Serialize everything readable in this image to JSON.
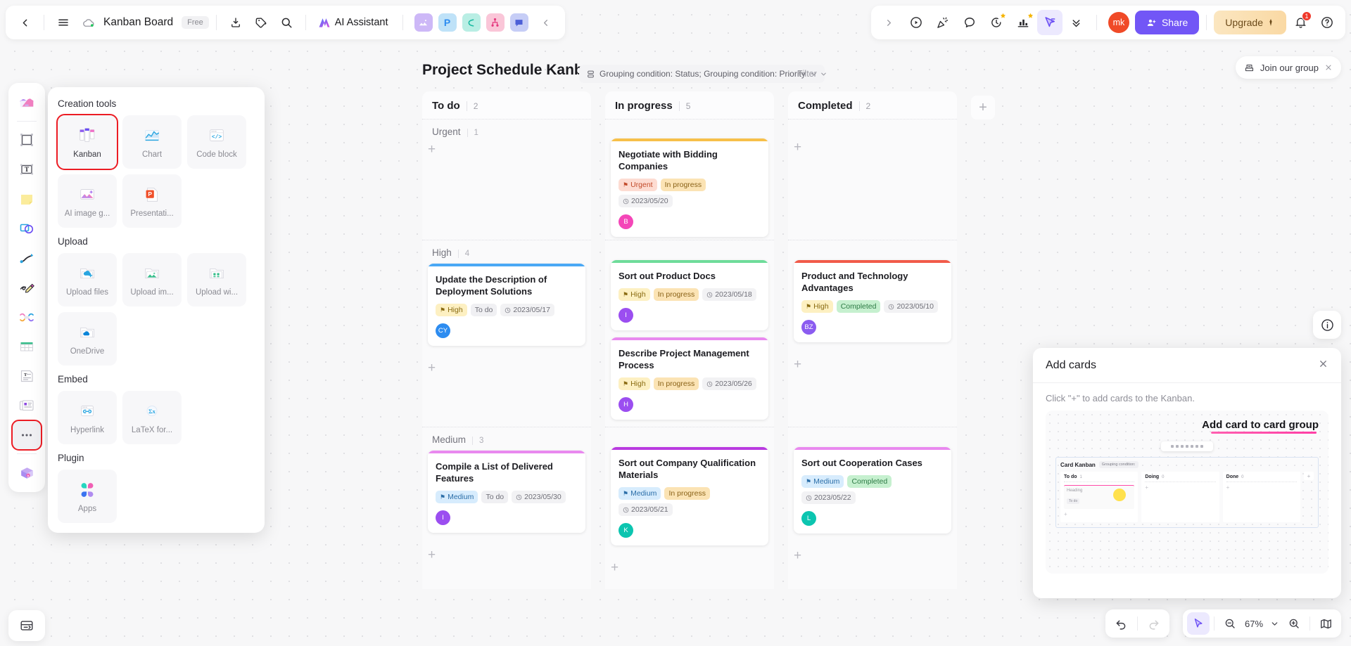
{
  "topbar": {
    "back_icon": "chevron-left-icon",
    "menu_icon": "hamburger-menu-icon",
    "cloud_icon": "cloud-sync-icon",
    "doc_title": "Kanban Board",
    "plan_badge": "Free",
    "download_icon": "download-icon",
    "tag_icon": "tag-icon",
    "search_icon": "search-icon",
    "ai_assistant_label": "AI Assistant",
    "applets": [
      {
        "name": "ai-image-applet",
        "color": "#cdb8f7"
      },
      {
        "name": "presentation-applet",
        "color": "#bfe2f8"
      },
      {
        "name": "mindmap-applet",
        "color": "#b9eee4"
      },
      {
        "name": "flowchart-applet",
        "color": "#fac6d8"
      },
      {
        "name": "comment-applet",
        "color": "#c6cdf6"
      }
    ],
    "collapse_icon": "chevron-left-icon",
    "right_tools": [
      {
        "name": "expand-right-icon",
        "glyph": "chevron-right-icon"
      },
      {
        "name": "present-icon",
        "glyph": "play-circle-icon"
      },
      {
        "name": "celebrate-icon",
        "glyph": "party-popper-icon"
      },
      {
        "name": "comment-icon",
        "glyph": "speech-bubble-icon"
      },
      {
        "name": "timer-icon",
        "glyph": "timer-star-icon"
      },
      {
        "name": "vote-icon",
        "glyph": "chart-star-icon"
      },
      {
        "name": "pointer-share-icon",
        "glyph": "cursor-list-icon"
      },
      {
        "name": "more-tools-icon",
        "glyph": "double-chevron-down-icon"
      }
    ],
    "avatar_initials": "mk",
    "share_label": "Share",
    "share_icon": "user-plus-icon",
    "upgrade_label": "Upgrade",
    "upgrade_icon": "diamond-icon",
    "bell_icon": "bell-icon",
    "bell_count": "1",
    "help_icon": "question-circle-icon"
  },
  "rail": {
    "items": [
      {
        "name": "rail-item-templates",
        "icon": "template-gallery-icon",
        "selected": false
      },
      {
        "name": "rail-item-frame",
        "icon": "frame-icon",
        "selected": false
      },
      {
        "name": "rail-item-text",
        "icon": "text-box-icon",
        "selected": false
      },
      {
        "name": "rail-item-sticky",
        "icon": "sticky-note-icon",
        "selected": false
      },
      {
        "name": "rail-item-shape",
        "icon": "shapes-icon",
        "selected": false
      },
      {
        "name": "rail-item-connector",
        "icon": "connector-line-icon",
        "selected": false
      },
      {
        "name": "rail-item-pen",
        "icon": "pen-scribble-icon",
        "selected": false
      },
      {
        "name": "rail-item-relation",
        "icon": "relation-icon",
        "selected": false
      },
      {
        "name": "rail-item-table",
        "icon": "table-icon",
        "selected": false
      },
      {
        "name": "rail-item-doc",
        "icon": "document-icon",
        "selected": false
      },
      {
        "name": "rail-item-cards",
        "icon": "cards-icon",
        "selected": false
      },
      {
        "name": "rail-item-more",
        "icon": "more-dots-icon",
        "selected": true
      },
      {
        "name": "rail-item-assets",
        "icon": "asset-box-icon",
        "selected": false
      }
    ],
    "bottom_icon": "export-board-icon"
  },
  "creation_popover": {
    "sections": [
      {
        "title": "Creation tools",
        "items": [
          {
            "label": "Kanban",
            "icon": "kanban-icon",
            "selected": true
          },
          {
            "label": "Chart",
            "icon": "chart-icon",
            "selected": false
          },
          {
            "label": "Code block",
            "icon": "code-block-icon",
            "selected": false
          },
          {
            "label": "AI image g...",
            "icon": "ai-image-icon",
            "selected": false
          },
          {
            "label": "Presentati...",
            "icon": "presentation-icon",
            "selected": false
          }
        ]
      },
      {
        "title": "Upload",
        "items": [
          {
            "label": "Upload files",
            "icon": "upload-files-icon",
            "selected": false
          },
          {
            "label": "Upload im...",
            "icon": "upload-image-icon",
            "selected": false
          },
          {
            "label": "Upload wi...",
            "icon": "upload-widget-icon",
            "selected": false
          },
          {
            "label": "OneDrive",
            "icon": "onedrive-icon",
            "selected": false
          }
        ]
      },
      {
        "title": "Embed",
        "items": [
          {
            "label": "Hyperlink",
            "icon": "hyperlink-icon",
            "selected": false
          },
          {
            "label": "LaTeX for...",
            "icon": "latex-formula-icon",
            "selected": false
          }
        ]
      },
      {
        "title": "Plugin",
        "items": [
          {
            "label": "Apps",
            "icon": "apps-icon",
            "selected": false
          }
        ]
      }
    ]
  },
  "board": {
    "title": "Project Schedule Kanban",
    "grouping_icon": "grouping-icon",
    "grouping_label": "Grouping condition: Status; Grouping condition: Priority",
    "filter_label": "Filter",
    "join_group_label": "Join our group",
    "join_group_icon": "mailbox-icon",
    "join_group_close_icon": "close-icon",
    "info_icon": "info-circle-icon",
    "add_column_icon": "plus-icon",
    "columns": [
      {
        "name": "To do",
        "count": "2",
        "swimlanes": [
          {
            "name": "Urgent",
            "count": "1",
            "cards": []
          },
          {
            "name": "High",
            "count": "4",
            "cards": [
              {
                "title": "Update the Description of Deployment Solutions",
                "bar_color": "#4aa8f5",
                "priority": "High",
                "priority_bg": "#fdf0c2",
                "priority_fg": "#8a6b12",
                "status": "To do",
                "status_bg": "#f0f0f3",
                "status_fg": "#6e6e77",
                "date": "2023/05/17",
                "avatar": "CY",
                "avatar_color": "#2d8cf0"
              }
            ]
          },
          {
            "name": "Medium",
            "count": "3",
            "cards": [
              {
                "title": "Compile a List of Delivered Features",
                "bar_color": "#e989ef",
                "priority": "Medium",
                "priority_bg": "#d7ecfd",
                "priority_fg": "#2b6ea8",
                "status": "To do",
                "status_bg": "#f0f0f3",
                "status_fg": "#6e6e77",
                "date": "2023/05/30",
                "avatar": "I",
                "avatar_color": "#9b4ef0"
              }
            ]
          }
        ]
      },
      {
        "name": "In progress",
        "count": "5",
        "swimlanes": [
          {
            "name": "",
            "count": "",
            "cards": [
              {
                "title": "Negotiate with Bidding Companies",
                "bar_color": "#f7c04a",
                "priority": "Urgent",
                "priority_bg": "#fddcd2",
                "priority_fg": "#c24a2a",
                "status": "In progress",
                "status_bg": "#fbe3b4",
                "status_fg": "#8a6218",
                "date": "2023/05/20",
                "avatar": "B",
                "avatar_color": "#f446b8"
              }
            ]
          },
          {
            "name": "",
            "count": "",
            "cards": [
              {
                "title": "Sort out Product Docs",
                "bar_color": "#6edc9a",
                "priority": "High",
                "priority_bg": "#fdf0c2",
                "priority_fg": "#8a6b12",
                "status": "In progress",
                "status_bg": "#fbe3b4",
                "status_fg": "#8a6218",
                "date": "2023/05/18",
                "avatar": "I",
                "avatar_color": "#9b4ef0"
              },
              {
                "title": "Describe Project Management Process",
                "bar_color": "#e989ef",
                "priority": "High",
                "priority_bg": "#fdf0c2",
                "priority_fg": "#8a6b12",
                "status": "In progress",
                "status_bg": "#fbe3b4",
                "status_fg": "#8a6218",
                "date": "2023/05/26",
                "avatar": "H",
                "avatar_color": "#9b4ef0"
              }
            ]
          },
          {
            "name": "",
            "count": "",
            "cards": [
              {
                "title": "Sort out Company Qualification Materials",
                "bar_color": "#b93ae0",
                "priority": "Medium",
                "priority_bg": "#d7ecfd",
                "priority_fg": "#2b6ea8",
                "status": "In progress",
                "status_bg": "#fbe3b4",
                "status_fg": "#8a6218",
                "date": "2023/05/21",
                "avatar": "K",
                "avatar_color": "#0cc5b0"
              }
            ]
          }
        ]
      },
      {
        "name": "Completed",
        "count": "2",
        "swimlanes": [
          {
            "name": "",
            "count": "",
            "cards": []
          },
          {
            "name": "",
            "count": "",
            "cards": [
              {
                "title": "Product and Technology Advantages",
                "bar_color": "#f15b4a",
                "priority": "High",
                "priority_bg": "#fdf0c2",
                "priority_fg": "#8a6b12",
                "status": "Completed",
                "status_bg": "#c6f0cf",
                "status_fg": "#2c7a44",
                "date": "2023/05/10",
                "avatar": "BZ",
                "avatar_color": "#8b5cf0"
              }
            ]
          },
          {
            "name": "",
            "count": "",
            "cards": [
              {
                "title": "Sort out Cooperation Cases",
                "bar_color": "#e989ef",
                "priority": "Medium",
                "priority_bg": "#d7ecfd",
                "priority_fg": "#2b6ea8",
                "status": "Completed",
                "status_bg": "#c6f0cf",
                "status_fg": "#2c7a44",
                "date": "2023/05/22",
                "avatar": "L",
                "avatar_color": "#0cc5b0"
              }
            ]
          }
        ]
      }
    ]
  },
  "add_cards_panel": {
    "title": "Add cards",
    "close_icon": "close-icon",
    "hint": "Click \"+\" to add cards to the Kanban.",
    "preview": {
      "heading": "Add card to card group",
      "kanban_name": "Card Kanban",
      "grouping_chip": "Grouping condition:",
      "columns": [
        {
          "name": "To do",
          "count": "1",
          "has_card": true,
          "card_title": "Heading",
          "card_tag": "To do"
        },
        {
          "name": "Doing",
          "count": "0",
          "has_card": false
        },
        {
          "name": "Done",
          "count": "0",
          "has_card": false
        }
      ]
    }
  },
  "bottom_toolbar": {
    "undo_icon": "undo-icon",
    "redo_icon": "redo-icon",
    "select_icon": "cursor-select-icon",
    "zoom_out_icon": "zoom-out-icon",
    "zoom_level": "67%",
    "zoom_dropdown_icon": "chevron-down-icon",
    "zoom_in_icon": "zoom-in-icon",
    "minimap_icon": "minimap-icon"
  },
  "colors": {
    "accent": "#7256f6",
    "selection_red": "#ec1c24",
    "upgrade": "#fad9a4"
  }
}
